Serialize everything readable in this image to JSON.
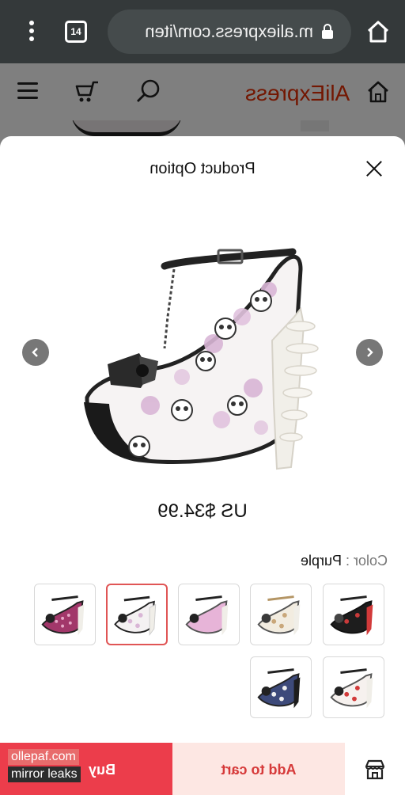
{
  "browser": {
    "url": "m.aliexpress.com/iten",
    "tab_count": "14",
    "icons": [
      "menu-dots-icon",
      "tabs-icon",
      "lock-icon",
      "home-icon"
    ]
  },
  "site_header": {
    "logo": "AliExpress",
    "icons": [
      "hamburger-icon",
      "cart-icon",
      "search-icon",
      "home-icon"
    ]
  },
  "sheet": {
    "title": "Product Option",
    "price": "US $34.99",
    "color_label": "Color",
    "color_separator": " : ",
    "color_value": "Purple",
    "thumbnails_selected_index": 3,
    "thumbnail_variants": [
      "red-black",
      "cream-skull",
      "pink",
      "white-skull",
      "pink-polka",
      "red-floral",
      "navy-floral"
    ]
  },
  "bottom_bar": {
    "buy_label": "Buy",
    "add_to_cart_label": "Add to cart",
    "store_icon": "store-icon"
  },
  "watermark": {
    "line1": "ollepaf.com",
    "line2": "mirror leaks"
  },
  "colors": {
    "browser_bar": "#34393a",
    "brand": "#e62e04",
    "buy_button": "#ec3d4b",
    "cart_button": "#fde7e3",
    "selected_border": "#e05555"
  }
}
